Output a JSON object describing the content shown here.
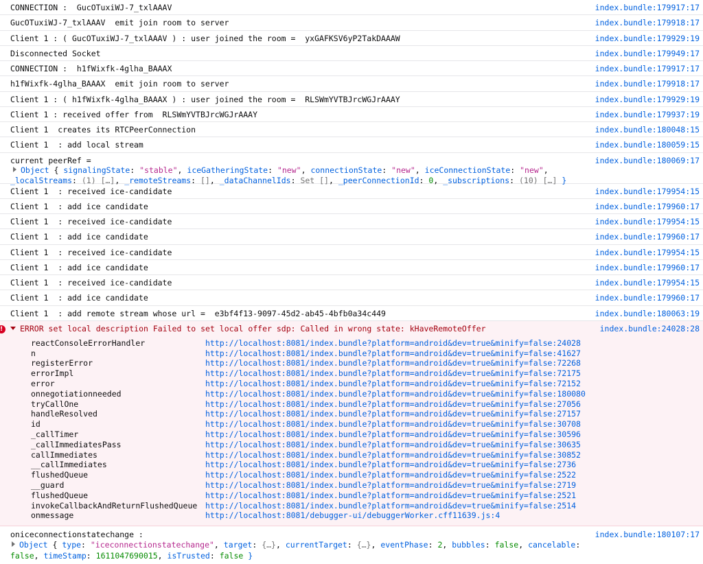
{
  "simple_rows": [
    {
      "text": "CONNECTION :  GucOTuxiWJ-7_txlAAAV",
      "source": "index.bundle:179917:17"
    },
    {
      "text": "GucOTuxiWJ-7_txlAAAV  emit join room to server",
      "source": "index.bundle:179918:17"
    },
    {
      "text": "Client 1 : ( GucOTuxiWJ-7_txlAAAV ) : user joined the room =  yxGAFKSV6yP2TakDAAAW",
      "source": "index.bundle:179929:19"
    },
    {
      "text": "Disconnected Socket",
      "source": "index.bundle:179949:17"
    },
    {
      "text": "CONNECTION :  h1fWixfk-4glha_BAAAX",
      "source": "index.bundle:179917:17"
    },
    {
      "text": "h1fWixfk-4glha_BAAAX  emit join room to server",
      "source": "index.bundle:179918:17"
    },
    {
      "text": "Client 1 : ( h1fWixfk-4glha_BAAAX ) : user joined the room =  RLSWmYVTBJrcWGJrAAAY",
      "source": "index.bundle:179929:19"
    },
    {
      "text": "Client 1 : received offer from  RLSWmYVTBJrcWGJrAAAY",
      "source": "index.bundle:179937:19"
    },
    {
      "text": "Client 1  creates its RTCPeerConnection",
      "source": "index.bundle:180048:15"
    },
    {
      "text": "Client 1  : add local stream",
      "source": "index.bundle:180059:15"
    }
  ],
  "peer_ref": {
    "label": "current peerRef =",
    "source": "index.bundle:180069:17",
    "line1": {
      "type": "Object",
      "open": "{ ",
      "k1": "signalingState",
      "v1": "\"stable\"",
      "k2": "iceGatheringState",
      "v2": "\"new\"",
      "k3": "connectionState",
      "v3": "\"new\"",
      "k4": "iceConnectionState",
      "v4": "\"new\""
    },
    "line2": {
      "k5": "_localStreams",
      "v5": "(1) […]",
      "k6": "_remoteStreams",
      "v6": "[]",
      "k7": "_dataChannelIds",
      "v7": "Set []",
      "k8": "_peerConnectionId",
      "v8": "0",
      "k9": "_subscriptions",
      "v9": "(10) […]",
      "close": "}"
    }
  },
  "ice_rows": [
    {
      "text": "Client 1  : received ice-candidate",
      "source": "index.bundle:179954:15"
    },
    {
      "text": "Client 1  : add ice candidate",
      "source": "index.bundle:179960:17"
    },
    {
      "text": "Client 1  : received ice-candidate",
      "source": "index.bundle:179954:15"
    },
    {
      "text": "Client 1  : add ice candidate",
      "source": "index.bundle:179960:17"
    },
    {
      "text": "Client 1  : received ice-candidate",
      "source": "index.bundle:179954:15"
    },
    {
      "text": "Client 1  : add ice candidate",
      "source": "index.bundle:179960:17"
    },
    {
      "text": "Client 1  : received ice-candidate",
      "source": "index.bundle:179954:15"
    },
    {
      "text": "Client 1  : add ice candidate",
      "source": "index.bundle:179960:17"
    },
    {
      "text": "Client 1  : add remote stream whose url =  e3bf4f13-9097-45d2-ab45-4bfb0a34c449",
      "source": "index.bundle:180063:19"
    }
  ],
  "error": {
    "icon": "error-icon",
    "message": "ERROR set local description Failed to set local offer sdp: Called in wrong state: kHaveRemoteOffer",
    "source": "index.bundle:24028:28",
    "stack": [
      {
        "fn": "reactConsoleErrorHandler",
        "loc": "http://localhost:8081/index.bundle?platform=android&dev=true&minify=false:24028"
      },
      {
        "fn": "n",
        "loc": "http://localhost:8081/index.bundle?platform=android&dev=true&minify=false:41627"
      },
      {
        "fn": "registerError",
        "loc": "http://localhost:8081/index.bundle?platform=android&dev=true&minify=false:72268"
      },
      {
        "fn": "errorImpl",
        "loc": "http://localhost:8081/index.bundle?platform=android&dev=true&minify=false:72175"
      },
      {
        "fn": "error",
        "loc": "http://localhost:8081/index.bundle?platform=android&dev=true&minify=false:72152"
      },
      {
        "fn": "onnegotiationneeded",
        "loc": "http://localhost:8081/index.bundle?platform=android&dev=true&minify=false:180080"
      },
      {
        "fn": "tryCallOne",
        "loc": "http://localhost:8081/index.bundle?platform=android&dev=true&minify=false:27056"
      },
      {
        "fn": "handleResolved",
        "loc": "http://localhost:8081/index.bundle?platform=android&dev=true&minify=false:27157"
      },
      {
        "fn": "id",
        "loc": "http://localhost:8081/index.bundle?platform=android&dev=true&minify=false:30708"
      },
      {
        "fn": "_callTimer",
        "loc": "http://localhost:8081/index.bundle?platform=android&dev=true&minify=false:30596"
      },
      {
        "fn": "_callImmediatesPass",
        "loc": "http://localhost:8081/index.bundle?platform=android&dev=true&minify=false:30635"
      },
      {
        "fn": "callImmediates",
        "loc": "http://localhost:8081/index.bundle?platform=android&dev=true&minify=false:30852"
      },
      {
        "fn": "__callImmediates",
        "loc": "http://localhost:8081/index.bundle?platform=android&dev=true&minify=false:2736"
      },
      {
        "fn": "flushedQueue",
        "loc": "http://localhost:8081/index.bundle?platform=android&dev=true&minify=false:2522"
      },
      {
        "fn": "__guard",
        "loc": "http://localhost:8081/index.bundle?platform=android&dev=true&minify=false:2719"
      },
      {
        "fn": "flushedQueue",
        "loc": "http://localhost:8081/index.bundle?platform=android&dev=true&minify=false:2521"
      },
      {
        "fn": "invokeCallbackAndReturnFlushedQueue",
        "loc": "http://localhost:8081/index.bundle?platform=android&dev=true&minify=false:2514"
      },
      {
        "fn": "onmessage",
        "loc": "http://localhost:8081/debugger-ui/debuggerWorker.cff11639.js:4"
      }
    ]
  },
  "ice_state": {
    "label": "oniceconnectionstatechange :",
    "source": "index.bundle:180107:17",
    "line1": {
      "type": "Object",
      "open": "{ ",
      "k1": "type",
      "v1": "\"iceconnectionstatechange\"",
      "k2": "target",
      "v2": "{…}",
      "k3": "currentTarget",
      "v3": "{…}",
      "k4": "eventPhase",
      "v4": "2",
      "k5": "bubbles",
      "v5": "false",
      "k6": "cancelable"
    },
    "line2": {
      "v6": "false",
      "k7": "timeStamp",
      "v7": "1611047690015",
      "k8": "isTrusted",
      "v8": "false",
      "close": "}"
    }
  }
}
